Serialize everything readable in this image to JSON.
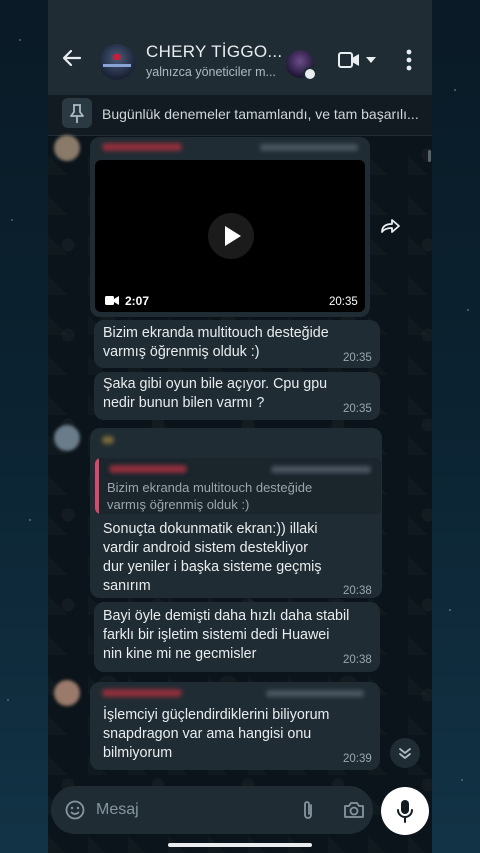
{
  "header": {
    "title": "CHERY TİGGO...",
    "subtitle": "yalnızca yöneticiler m..."
  },
  "pinned": {
    "text": "Bugünlük denemeler tamamlandı, ve tam başarılı..."
  },
  "messages": [
    {
      "type": "video",
      "duration": "2:07",
      "time": "20:35"
    },
    {
      "text": "Bizim ekranda multitouch desteğide\nvarmış öğrenmiş olduk :)",
      "time": "20:35"
    },
    {
      "text": "Şaka gibi oyun bile açıyor. Cpu gpu\nnedir bunun bilen varmı ?",
      "time": "20:35"
    },
    {
      "quoted": "Bizim ekranda multitouch desteğide\nvarmış öğrenmiş olduk :)",
      "text": "Sonuçta dokunmatik ekran:)) illaki\nvardir android sistem destekliyor\ndur yeniler i başka sisteme geçmiş\nsanırım",
      "time": "20:38"
    },
    {
      "text": "Bayi öyle demişti daha hızlı daha stabil\nfarklı bir işletim sistemi dedi Huawei\nnin kine mi ne gecmisler",
      "time": "20:38"
    },
    {
      "text": "İşlemciyi güçlendirdiklerini biliyorum\nsnapdragon var ama hangisi onu\nbilmiyorum",
      "time": "20:39"
    }
  ],
  "composer": {
    "placeholder": "Mesaj"
  },
  "icons": [
    "back-arrow-icon",
    "video-call-icon",
    "more-icon",
    "pin-icon",
    "play-icon",
    "video-camera-icon",
    "share-icon",
    "chevron-down-icon",
    "emoji-icon",
    "attach-icon",
    "camera-icon",
    "mic-icon"
  ],
  "colors": {
    "header": "#1f2c34",
    "bubble": "#202c33",
    "background": "#0b141a",
    "quote_accent": "#d54a6b",
    "sender_name": "#8e2f3c"
  }
}
